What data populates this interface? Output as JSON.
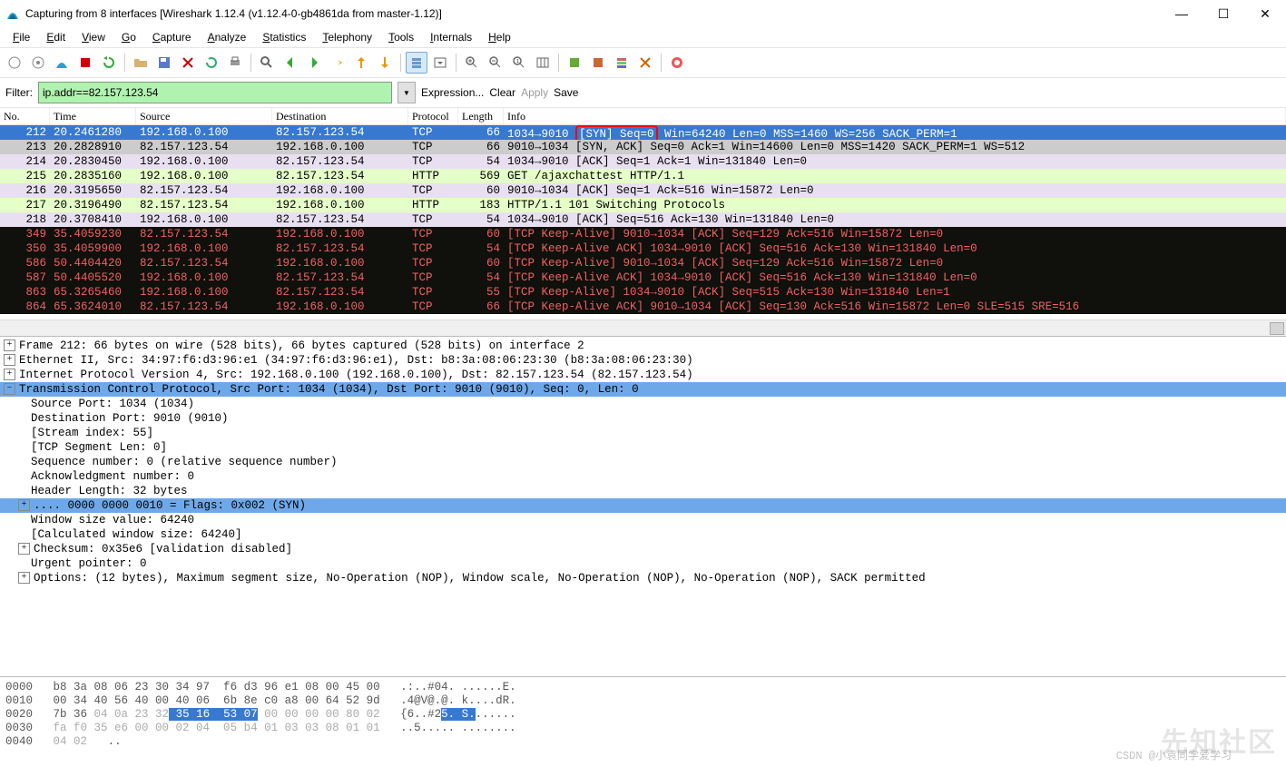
{
  "window": {
    "title": "Capturing from 8 interfaces   [Wireshark 1.12.4  (v1.12.4-0-gb4861da from master-1.12)]"
  },
  "menu": [
    "File",
    "Edit",
    "View",
    "Go",
    "Capture",
    "Analyze",
    "Statistics",
    "Telephony",
    "Tools",
    "Internals",
    "Help"
  ],
  "filter": {
    "label": "Filter:",
    "value": "ip.addr==82.157.123.54",
    "expr": "Expression...",
    "clear": "Clear",
    "apply": "Apply",
    "save": "Save"
  },
  "headers": [
    "No.",
    "Time",
    "Source",
    "Destination",
    "Protocol",
    "Length",
    "Info"
  ],
  "packets": [
    {
      "no": "212",
      "time": "20.2461280",
      "src": "192.168.0.100",
      "dst": "82.157.123.54",
      "proto": "TCP",
      "len": "66",
      "info_pre": "1034→9010 ",
      "info_box": "[SYN] Seq=0",
      "info_post": " Win=64240 Len=0 MSS=1460 WS=256 SACK_PERM=1",
      "cls": "sel"
    },
    {
      "no": "213",
      "time": "20.2828910",
      "src": "82.157.123.54",
      "dst": "192.168.0.100",
      "proto": "TCP",
      "len": "66",
      "info": "9010→1034 [SYN, ACK] Seq=0 Ack=1 Win=14600 Len=0 MSS=1420 SACK_PERM=1 WS=512",
      "cls": "gray"
    },
    {
      "no": "214",
      "time": "20.2830450",
      "src": "192.168.0.100",
      "dst": "82.157.123.54",
      "proto": "TCP",
      "len": "54",
      "info": "1034→9010 [ACK] Seq=1 Ack=1 Win=131840 Len=0",
      "cls": "lpurple"
    },
    {
      "no": "215",
      "time": "20.2835160",
      "src": "192.168.0.100",
      "dst": "82.157.123.54",
      "proto": "HTTP",
      "len": "569",
      "info": "GET /ajaxchattest HTTP/1.1",
      "cls": "lgreen"
    },
    {
      "no": "216",
      "time": "20.3195650",
      "src": "82.157.123.54",
      "dst": "192.168.0.100",
      "proto": "TCP",
      "len": "60",
      "info": "9010→1034 [ACK] Seq=1 Ack=516 Win=15872 Len=0",
      "cls": "lpurple"
    },
    {
      "no": "217",
      "time": "20.3196490",
      "src": "82.157.123.54",
      "dst": "192.168.0.100",
      "proto": "HTTP",
      "len": "183",
      "info": "HTTP/1.1 101 Switching Protocols",
      "cls": "lgreen"
    },
    {
      "no": "218",
      "time": "20.3708410",
      "src": "192.168.0.100",
      "dst": "82.157.123.54",
      "proto": "TCP",
      "len": "54",
      "info": "1034→9010 [ACK] Seq=516 Ack=130 Win=131840 Len=0",
      "cls": "lpurple"
    },
    {
      "no": "349",
      "time": "35.4059230",
      "src": "82.157.123.54",
      "dst": "192.168.0.100",
      "proto": "TCP",
      "len": "60",
      "info": "[TCP Keep-Alive] 9010→1034 [ACK] Seq=129 Ack=516 Win=15872 Len=0",
      "cls": "dark"
    },
    {
      "no": "350",
      "time": "35.4059900",
      "src": "192.168.0.100",
      "dst": "82.157.123.54",
      "proto": "TCP",
      "len": "54",
      "info": "[TCP Keep-Alive ACK] 1034→9010 [ACK] Seq=516 Ack=130 Win=131840 Len=0",
      "cls": "dark"
    },
    {
      "no": "586",
      "time": "50.4404420",
      "src": "82.157.123.54",
      "dst": "192.168.0.100",
      "proto": "TCP",
      "len": "60",
      "info": "[TCP Keep-Alive] 9010→1034 [ACK] Seq=129 Ack=516 Win=15872 Len=0",
      "cls": "dark"
    },
    {
      "no": "587",
      "time": "50.4405520",
      "src": "192.168.0.100",
      "dst": "82.157.123.54",
      "proto": "TCP",
      "len": "54",
      "info": "[TCP Keep-Alive ACK] 1034→9010 [ACK] Seq=516 Ack=130 Win=131840 Len=0",
      "cls": "dark"
    },
    {
      "no": "863",
      "time": "65.3265460",
      "src": "192.168.0.100",
      "dst": "82.157.123.54",
      "proto": "TCP",
      "len": "55",
      "info": "[TCP Keep-Alive] 1034→9010 [ACK] Seq=515 Ack=130 Win=131840 Len=1",
      "cls": "dark"
    },
    {
      "no": "864",
      "time": "65.3624010",
      "src": "82.157.123.54",
      "dst": "192.168.0.100",
      "proto": "TCP",
      "len": "66",
      "info": "[TCP Keep-Alive ACK] 9010→1034 [ACK] Seq=130 Ack=516 Win=15872 Len=0 SLE=515 SRE=516",
      "cls": "dark"
    }
  ],
  "details": [
    {
      "exp": "+",
      "txt": "Frame 212: 66 bytes on wire (528 bits), 66 bytes captured (528 bits) on interface 2"
    },
    {
      "exp": "+",
      "txt": "Ethernet II, Src: 34:97:f6:d3:96:e1 (34:97:f6:d3:96:e1), Dst: b8:3a:08:06:23:30 (b8:3a:08:06:23:30)"
    },
    {
      "exp": "+",
      "txt": "Internet Protocol Version 4, Src: 192.168.0.100 (192.168.0.100), Dst: 82.157.123.54 (82.157.123.54)"
    },
    {
      "exp": "−",
      "txt": "Transmission Control Protocol, Src Port: 1034 (1034), Dst Port: 9010 (9010), Seq: 0, Len: 0",
      "sel": true
    },
    {
      "ind": 2,
      "txt": "Source Port: 1034 (1034)"
    },
    {
      "ind": 2,
      "txt": "Destination Port: 9010 (9010)"
    },
    {
      "ind": 2,
      "txt": "[Stream index: 55]"
    },
    {
      "ind": 2,
      "txt": "[TCP Segment Len: 0]"
    },
    {
      "ind": 2,
      "txt": "Sequence number: 0    (relative sequence number)"
    },
    {
      "ind": 2,
      "txt": "Acknowledgment number: 0"
    },
    {
      "ind": 2,
      "txt": "Header Length: 32 bytes"
    },
    {
      "exp": "+",
      "ind": 1,
      "txt": ".... 0000 0000 0010 = Flags: 0x002 (SYN)",
      "sel": true
    },
    {
      "ind": 2,
      "txt": "Window size value: 64240"
    },
    {
      "ind": 2,
      "txt": "[Calculated window size: 64240]"
    },
    {
      "exp": "+",
      "ind": 1,
      "txt": "Checksum: 0x35e6 [validation disabled]"
    },
    {
      "ind": 2,
      "txt": "Urgent pointer: 0"
    },
    {
      "exp": "+",
      "ind": 1,
      "txt": "Options: (12 bytes), Maximum segment size, No-Operation (NOP), Window scale, No-Operation (NOP), No-Operation (NOP), SACK permitted"
    }
  ],
  "hex": [
    {
      "off": "0000",
      "b": "b8 3a 08 06 23 30 34 97  f6 d3 96 e1 08 00 45 00",
      "a": ".:..#04. ......E."
    },
    {
      "off": "0010",
      "b": "00 34 40 56 40 00 40 06  6b 8e c0 a8 00 64 52 9d",
      "a": ".4@V@.@. k....dR."
    },
    {
      "off": "0020",
      "b": "7b 36",
      "g": " 04 0a 23 32",
      "hl": " 35 16  53 07",
      "g2": " 00 00 00 00 80 02",
      "a": "{6..#2",
      "ahl": "5. S.",
      "a2": "......"
    },
    {
      "off": "0030",
      "g": "fa f0 35 e6 00 00 02 04  05 b4 01 03 03 08 01 01",
      "a": "..5..... ........"
    },
    {
      "off": "0040",
      "g": "04 02",
      "a": ".."
    }
  ],
  "watermark": "先知社区",
  "wm2": "CSDN @小袁同学爱学习"
}
